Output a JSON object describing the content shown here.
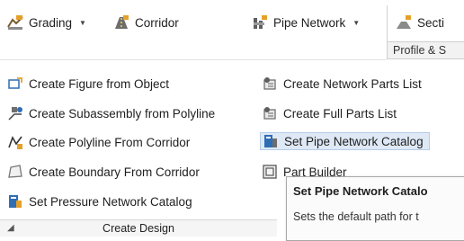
{
  "toolbar": {
    "grading": {
      "label": "Grading",
      "icon": "grading-icon"
    },
    "corridor": {
      "label": "Corridor",
      "icon": "corridor-icon"
    },
    "pipe_network": {
      "label": "Pipe Network",
      "icon": "pipe-network-icon"
    },
    "section": {
      "label": "Secti",
      "icon": "section-icon"
    },
    "profile_tab": "Profile & S"
  },
  "menu": {
    "left": [
      {
        "label": "Create Figure from Object",
        "icon": "create-figure-icon"
      },
      {
        "label": "Create Subassembly from Polyline",
        "icon": "subassembly-icon"
      },
      {
        "label": "Create Polyline From Corridor",
        "icon": "polyline-icon"
      },
      {
        "label": "Create Boundary From Corridor",
        "icon": "boundary-icon"
      },
      {
        "label": "Set Pressure Network Catalog",
        "icon": "pressure-catalog-icon"
      }
    ],
    "right": [
      {
        "label": "Create Network Parts List",
        "icon": "parts-list-icon"
      },
      {
        "label": "Create Full Parts List",
        "icon": "full-parts-list-icon"
      },
      {
        "label": "Set Pipe Network Catalog",
        "icon": "pipe-catalog-icon",
        "highlighted": true
      },
      {
        "label": "Part Builder",
        "icon": "part-builder-icon"
      }
    ]
  },
  "panel_title": "Create Design",
  "tooltip": {
    "title": "Set Pipe Network Catalo",
    "description": "Sets the default path for t"
  },
  "colors": {
    "highlight": "#dfe9f6",
    "highlight_border": "#b5cde8",
    "icon_blue": "#2f6db5",
    "icon_orange": "#e5a02a"
  }
}
